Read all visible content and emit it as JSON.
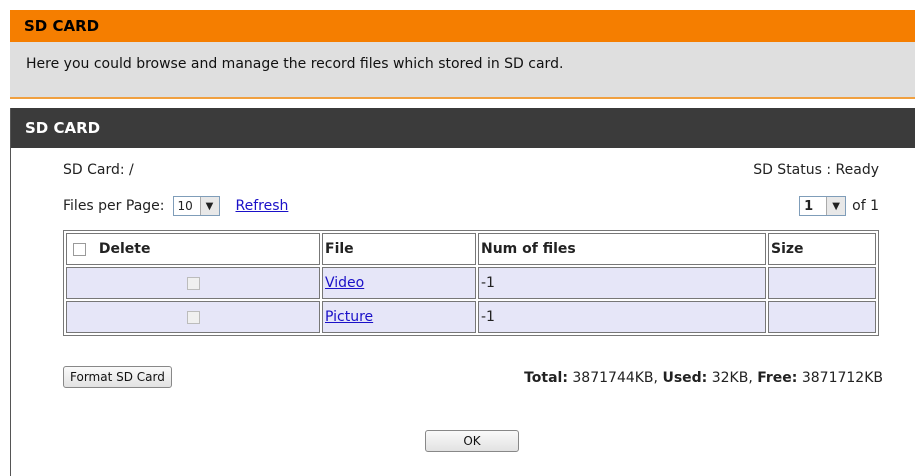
{
  "top_header": {
    "title": "SD CARD"
  },
  "intro": {
    "text": "Here you could browse and manage the record files which stored in SD card."
  },
  "panel": {
    "title": "SD CARD"
  },
  "sd_card": {
    "label": "SD Card: /",
    "status": "SD Status : Ready"
  },
  "files_per_page": {
    "label": "Files per Page:",
    "value": "10",
    "refresh": "Refresh"
  },
  "pager": {
    "value": "1",
    "of": "of 1"
  },
  "table": {
    "headers": {
      "delete": "Delete",
      "file": "File",
      "num": "Num of files",
      "size": "Size"
    },
    "rows": [
      {
        "file": "Video",
        "num": "-1",
        "size": ""
      },
      {
        "file": "Picture",
        "num": "-1",
        "size": ""
      }
    ]
  },
  "format_button": "Format SD Card",
  "totals": {
    "total_label": "Total:",
    "total_value": " 3871744KB, ",
    "used_label": "Used:",
    "used_value": " 32KB, ",
    "free_label": "Free:",
    "free_value": " 3871712KB"
  },
  "ok_button": "OK"
}
